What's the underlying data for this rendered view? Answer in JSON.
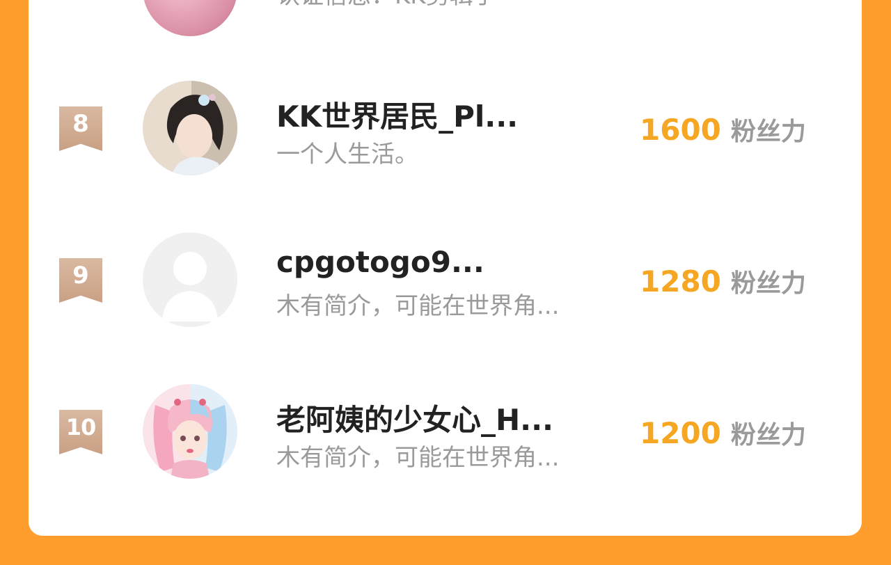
{
  "list": {
    "partial_item": {
      "desc": "认证信息：KK剪辑手"
    },
    "items": [
      {
        "rank": "8",
        "name": "KK世界居民_Pl...",
        "desc": "一个人生活。",
        "fans": "1600",
        "fans_unit": "粉丝力",
        "avatar": "woman-avatar"
      },
      {
        "rank": "9",
        "name": "cpgotogo9...",
        "desc": "木有简介，可能在世界角...",
        "fans": "1280",
        "fans_unit": "粉丝力",
        "avatar": "default-avatar"
      },
      {
        "rank": "10",
        "name": "老阿姨的少女心_H...",
        "desc": "木有简介，可能在世界角...",
        "fans": "1200",
        "fans_unit": "粉丝力",
        "avatar": "twin-girls-avatar"
      }
    ]
  },
  "colors": {
    "background": "#FF9E2C",
    "card": "#FFFFFF",
    "fans_number": "#F5A623",
    "rank_badge": "#D2AD93",
    "muted_text": "#9A9A9A"
  }
}
